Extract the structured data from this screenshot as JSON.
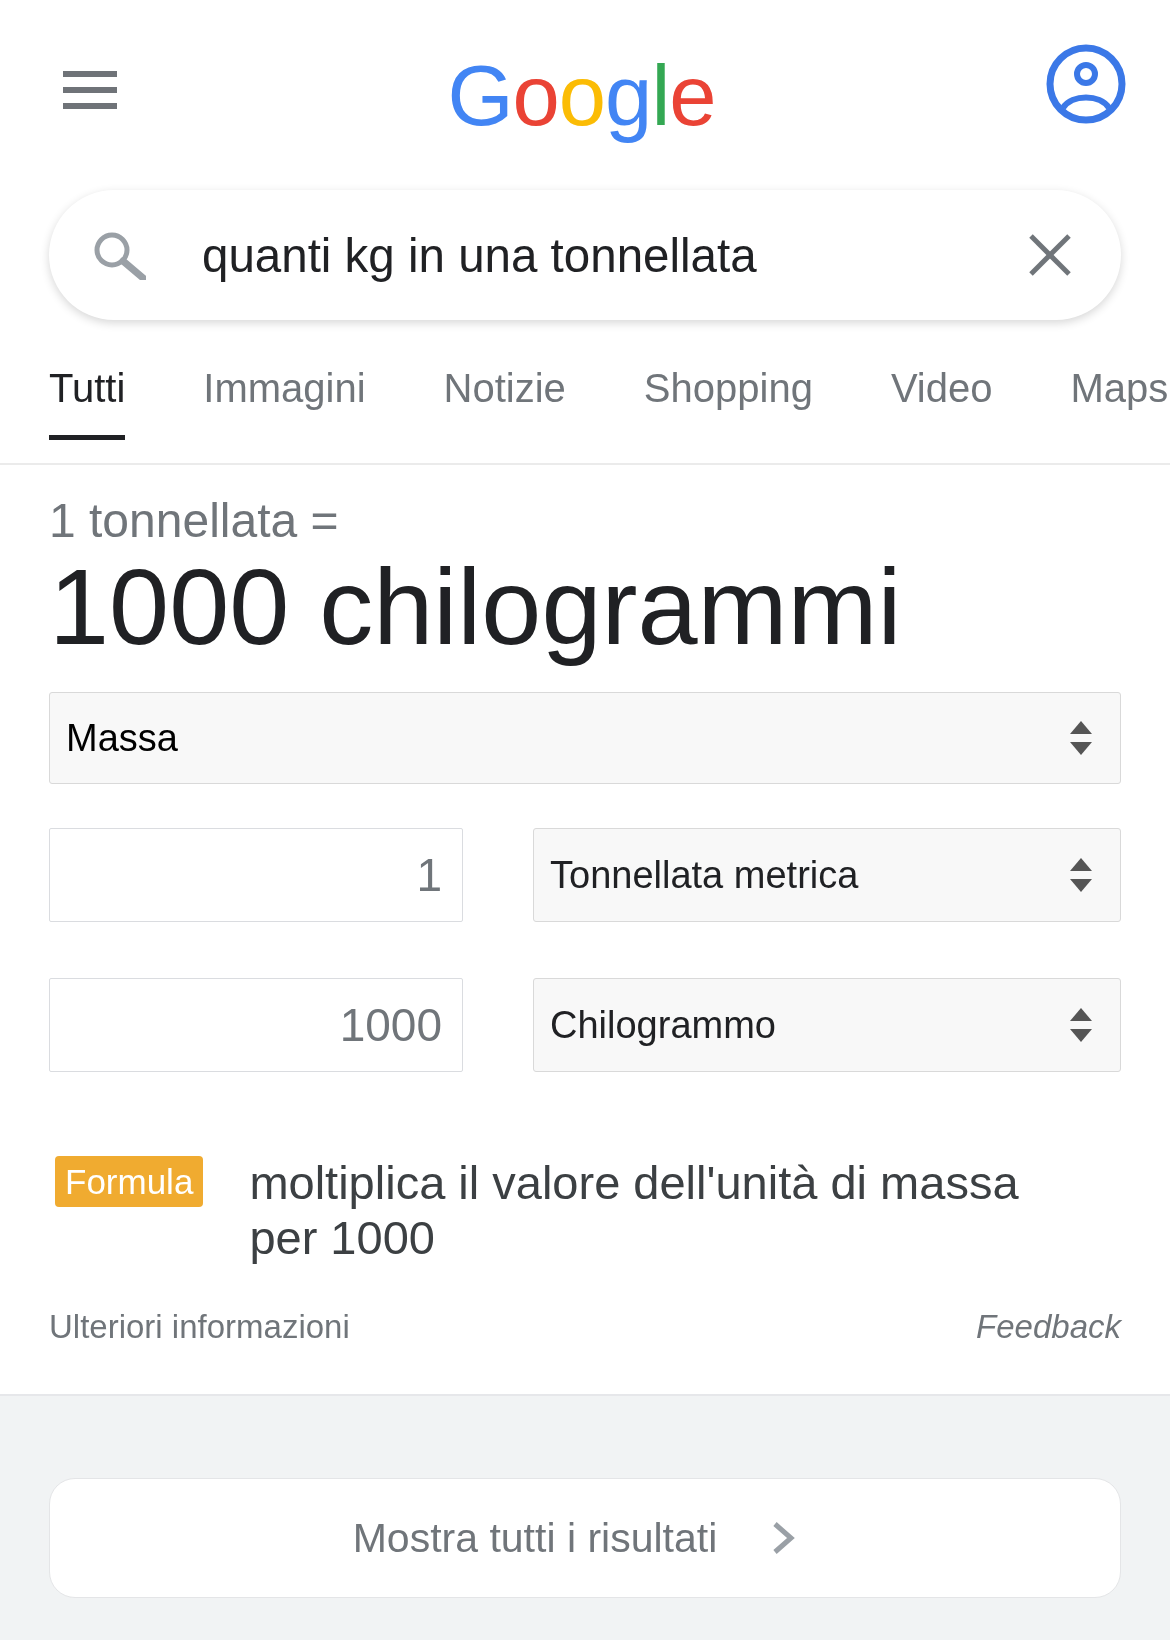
{
  "header": {
    "logo": "Google"
  },
  "search": {
    "query": "quanti kg in una tonnellata"
  },
  "tabs": [
    {
      "label": "Tutti",
      "selected": true
    },
    {
      "label": "Immagini",
      "selected": false
    },
    {
      "label": "Notizie",
      "selected": false
    },
    {
      "label": "Shopping",
      "selected": false
    },
    {
      "label": "Video",
      "selected": false
    },
    {
      "label": "Maps",
      "selected": false
    }
  ],
  "converter": {
    "equation": "1 tonnellata =",
    "result": "1000 chilogrammi",
    "quantity": "Massa",
    "rows": [
      {
        "value": "1",
        "unit": "Tonnellata metrica"
      },
      {
        "value": "1000",
        "unit": "Chilogrammo"
      }
    ],
    "formula": {
      "badge": "Formula",
      "text": "moltiplica il valore dell'unità di massa per 1000"
    },
    "more_info": "Ulteriori informazioni",
    "feedback": "Feedback"
  },
  "show_all": {
    "label": "Mostra tutti i risultati"
  }
}
